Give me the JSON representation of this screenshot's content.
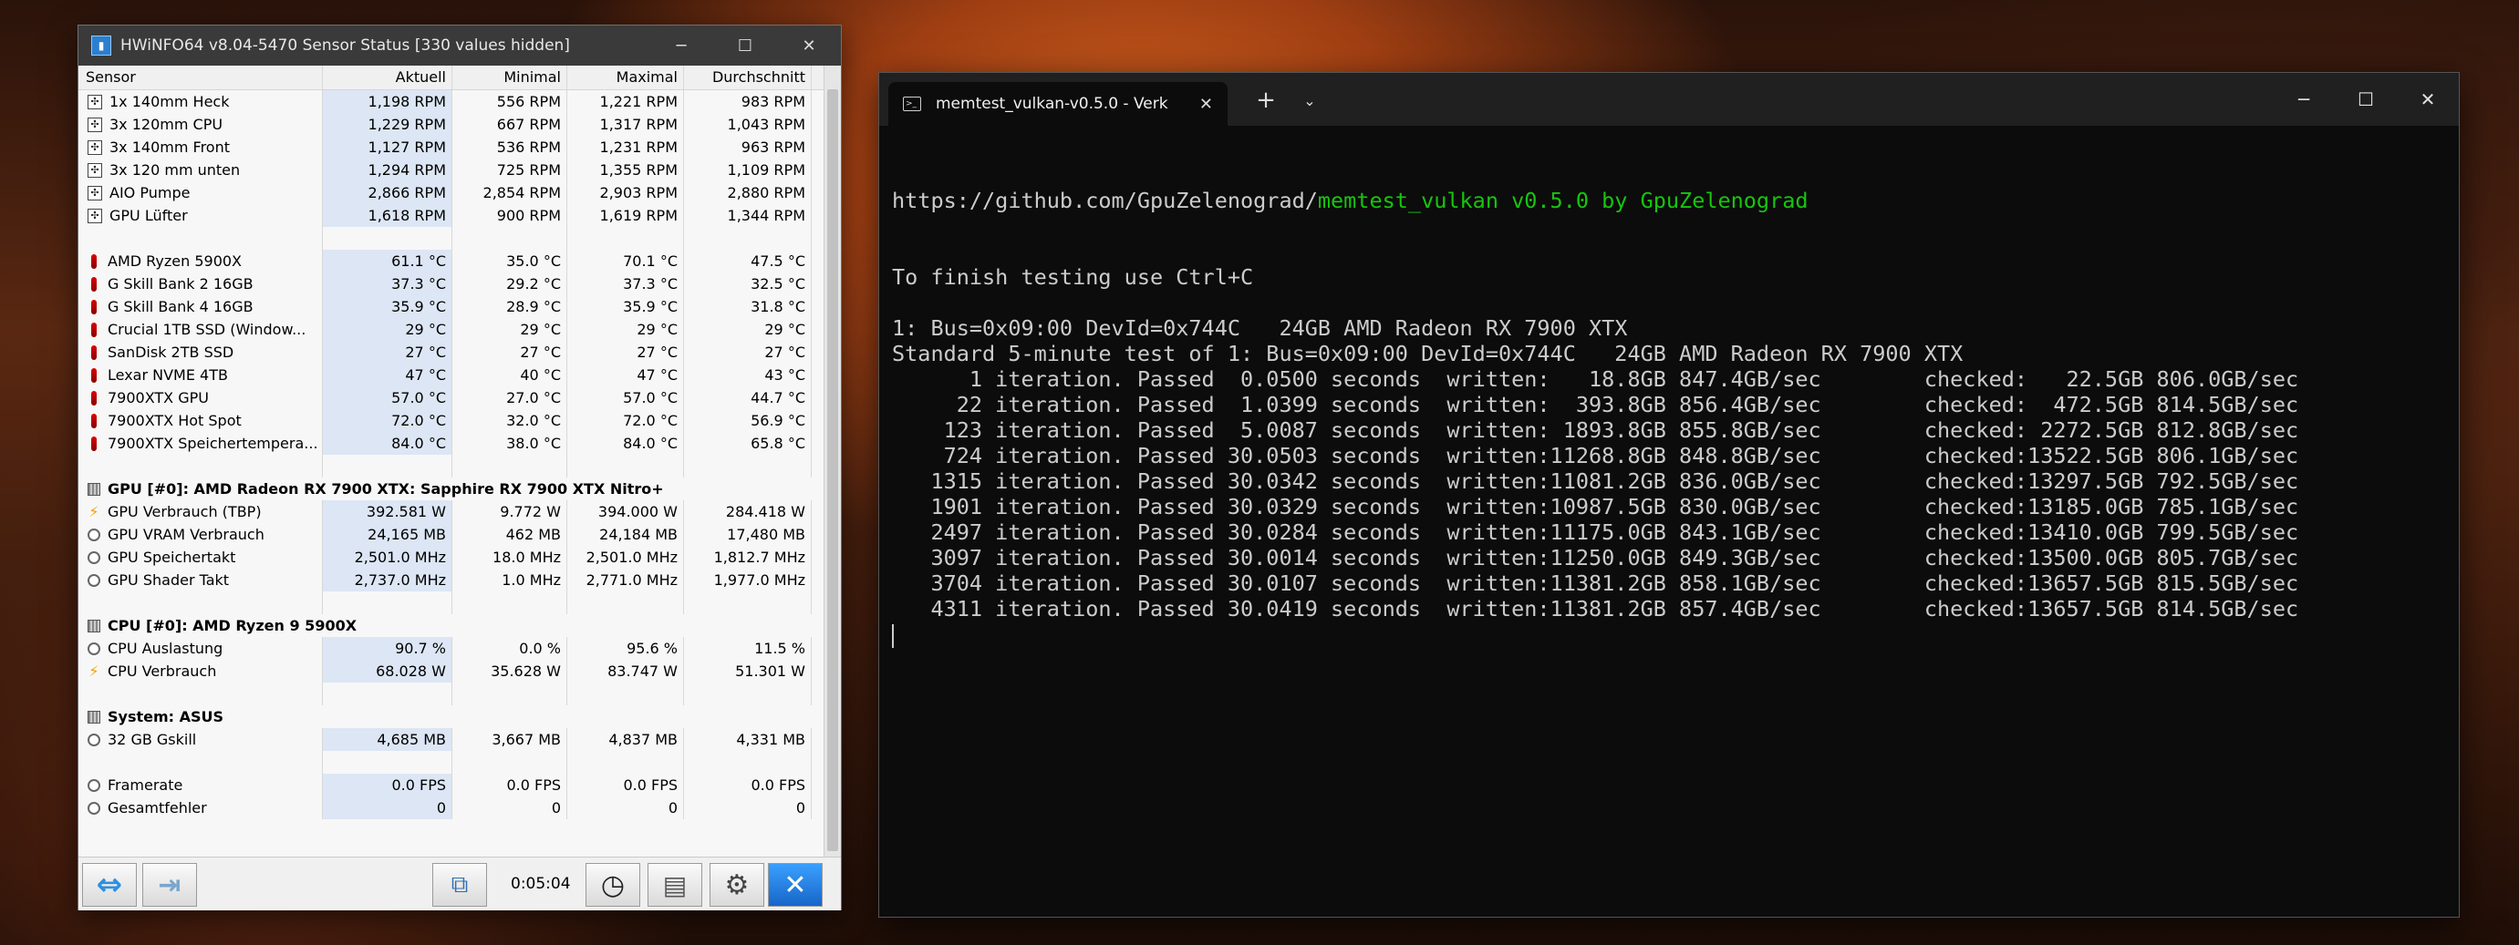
{
  "hwinfo": {
    "title": "HWiNFO64 v8.04-5470 Sensor Status [330 values hidden]",
    "columns": [
      "Sensor",
      "Aktuell",
      "Minimal",
      "Maximal",
      "Durchschnitt"
    ],
    "rows": [
      {
        "icon": "fan-icon",
        "label": "1x 140mm Heck",
        "v": [
          "1,198 RPM",
          "556 RPM",
          "1,221 RPM",
          "983 RPM"
        ]
      },
      {
        "icon": "fan-icon",
        "label": "3x 120mm CPU",
        "v": [
          "1,229 RPM",
          "667 RPM",
          "1,317 RPM",
          "1,043 RPM"
        ]
      },
      {
        "icon": "fan-icon",
        "label": "3x 140mm Front",
        "v": [
          "1,127 RPM",
          "536 RPM",
          "1,231 RPM",
          "963 RPM"
        ]
      },
      {
        "icon": "fan-icon",
        "label": "3x 120 mm unten",
        "v": [
          "1,294 RPM",
          "725 RPM",
          "1,355 RPM",
          "1,109 RPM"
        ]
      },
      {
        "icon": "fan-icon",
        "label": "AIO Pumpe",
        "v": [
          "2,866 RPM",
          "2,854 RPM",
          "2,903 RPM",
          "2,880 RPM"
        ]
      },
      {
        "icon": "fan-icon",
        "label": "GPU Lüfter",
        "v": [
          "1,618 RPM",
          "900 RPM",
          "1,619 RPM",
          "1,344 RPM"
        ]
      },
      {
        "blank": true
      },
      {
        "icon": "temp-icon",
        "label": "AMD Ryzen 5900X",
        "v": [
          "61.1 °C",
          "35.0 °C",
          "70.1 °C",
          "47.5 °C"
        ]
      },
      {
        "icon": "temp-icon",
        "label": "G Skill Bank 2 16GB",
        "v": [
          "37.3 °C",
          "29.2 °C",
          "37.3 °C",
          "32.5 °C"
        ]
      },
      {
        "icon": "temp-icon",
        "label": "G Skill Bank 4 16GB",
        "v": [
          "35.9 °C",
          "28.9 °C",
          "35.9 °C",
          "31.8 °C"
        ]
      },
      {
        "icon": "temp-icon",
        "label": "Crucial 1TB SSD (Window...",
        "v": [
          "29 °C",
          "29 °C",
          "29 °C",
          "29 °C"
        ]
      },
      {
        "icon": "temp-icon",
        "label": "SanDisk 2TB SSD",
        "v": [
          "27 °C",
          "27 °C",
          "27 °C",
          "27 °C"
        ]
      },
      {
        "icon": "temp-icon",
        "label": "Lexar NVME 4TB",
        "v": [
          "47 °C",
          "40 °C",
          "47 °C",
          "43 °C"
        ]
      },
      {
        "icon": "temp-icon",
        "label": "7900XTX GPU",
        "v": [
          "57.0 °C",
          "27.0 °C",
          "57.0 °C",
          "44.7 °C"
        ]
      },
      {
        "icon": "temp-icon",
        "label": "7900XTX Hot Spot",
        "v": [
          "72.0 °C",
          "32.0 °C",
          "72.0 °C",
          "56.9 °C"
        ]
      },
      {
        "icon": "temp-icon",
        "label": "7900XTX Speichertempera...",
        "v": [
          "84.0 °C",
          "38.0 °C",
          "84.0 °C",
          "65.8 °C"
        ]
      },
      {
        "blank": true
      },
      {
        "group": true,
        "icon": "chip-icon",
        "label": "GPU [#0]: AMD Radeon RX 7900 XTX: Sapphire RX 7900 XTX Nitro+"
      },
      {
        "icon": "bolt-icon",
        "label": "GPU Verbrauch (TBP)",
        "v": [
          "392.581 W",
          "9.772 W",
          "394.000 W",
          "284.418 W"
        ]
      },
      {
        "icon": "circle-icon",
        "label": "GPU VRAM Verbrauch",
        "v": [
          "24,165 MB",
          "462 MB",
          "24,184 MB",
          "17,480 MB"
        ]
      },
      {
        "icon": "circle-icon",
        "label": "GPU Speichertakt",
        "v": [
          "2,501.0 MHz",
          "18.0 MHz",
          "2,501.0 MHz",
          "1,812.7 MHz"
        ]
      },
      {
        "icon": "circle-icon",
        "label": "GPU Shader Takt",
        "v": [
          "2,737.0 MHz",
          "1.0 MHz",
          "2,771.0 MHz",
          "1,977.0 MHz"
        ]
      },
      {
        "blank": true
      },
      {
        "group": true,
        "icon": "chip-icon",
        "label": "CPU [#0]: AMD Ryzen 9 5900X"
      },
      {
        "icon": "circle-icon",
        "label": "CPU Auslastung",
        "v": [
          "90.7 %",
          "0.0 %",
          "95.6 %",
          "11.5 %"
        ]
      },
      {
        "icon": "bolt-icon",
        "label": "CPU Verbrauch",
        "v": [
          "68.028 W",
          "35.628 W",
          "83.747 W",
          "51.301 W"
        ]
      },
      {
        "blank": true
      },
      {
        "group": true,
        "icon": "chip-icon",
        "label": "System: ASUS"
      },
      {
        "icon": "circle-icon",
        "label": "32 GB Gskill",
        "v": [
          "4,685 MB",
          "3,667 MB",
          "4,837 MB",
          "4,331 MB"
        ]
      },
      {
        "blank": true
      },
      {
        "icon": "circle-icon",
        "label": "Framerate",
        "v": [
          "0.0 FPS",
          "0.0 FPS",
          "0.0 FPS",
          "0.0 FPS"
        ]
      },
      {
        "icon": "circle-icon",
        "label": "Gesamtfehler",
        "v": [
          "0",
          "0",
          "0",
          "0"
        ]
      }
    ],
    "timer": "0:05:04"
  },
  "terminal": {
    "tab_title": "memtest_vulkan-v0.5.0 - Verk",
    "url_prefix": "https://github.com/GpuZelenograd/",
    "url_highlight": "memtest_vulkan v0.5.0 by GpuZelenograd",
    "lines": [
      "To finish testing use Ctrl+C",
      "",
      "1: Bus=0x09:00 DevId=0x744C   24GB AMD Radeon RX 7900 XTX",
      "Standard 5-minute test of 1: Bus=0x09:00 DevId=0x744C   24GB AMD Radeon RX 7900 XTX",
      "      1 iteration. Passed  0.0500 seconds  written:   18.8GB 847.4GB/sec        checked:   22.5GB 806.0GB/sec",
      "     22 iteration. Passed  1.0399 seconds  written:  393.8GB 856.4GB/sec        checked:  472.5GB 814.5GB/sec",
      "    123 iteration. Passed  5.0087 seconds  written: 1893.8GB 855.8GB/sec        checked: 2272.5GB 812.8GB/sec",
      "    724 iteration. Passed 30.0503 seconds  written:11268.8GB 848.8GB/sec        checked:13522.5GB 806.1GB/sec",
      "   1315 iteration. Passed 30.0342 seconds  written:11081.2GB 836.0GB/sec        checked:13297.5GB 792.5GB/sec",
      "   1901 iteration. Passed 30.0329 seconds  written:10987.5GB 830.0GB/sec        checked:13185.0GB 785.1GB/sec",
      "   2497 iteration. Passed 30.0284 seconds  written:11175.0GB 843.1GB/sec        checked:13410.0GB 799.5GB/sec",
      "   3097 iteration. Passed 30.0014 seconds  written:11250.0GB 849.3GB/sec        checked:13500.0GB 805.7GB/sec",
      "   3704 iteration. Passed 30.0107 seconds  written:11381.2GB 858.1GB/sec        checked:13657.5GB 815.5GB/sec",
      "   4311 iteration. Passed 30.0419 seconds  written:11381.2GB 857.4GB/sec        checked:13657.5GB 814.5GB/sec"
    ]
  },
  "colors": {
    "terminal_green": "#16c60c",
    "aktuell_highlight": "#dce6f4"
  }
}
